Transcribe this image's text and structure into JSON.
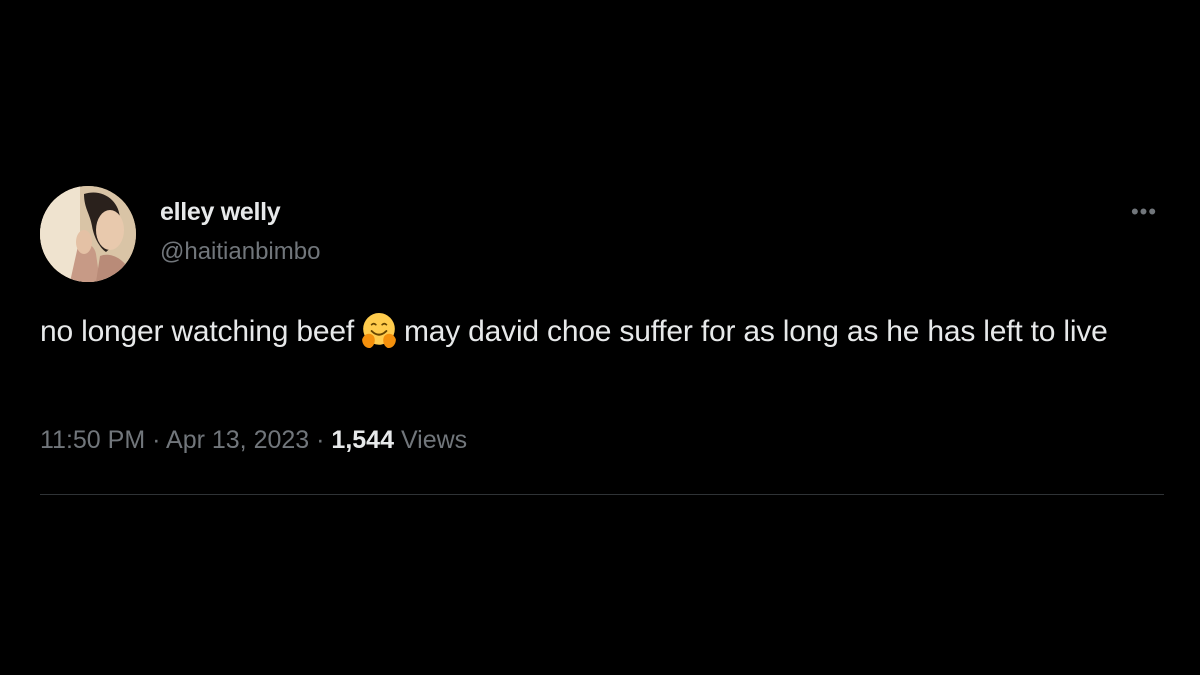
{
  "tweet": {
    "display_name": "elley welly",
    "handle": "@haitianbimbo",
    "more_icon": "more-horizontal-icon",
    "text_before_emoji": "no longer watching beef",
    "emoji": "hugging-face-emoji",
    "text_after_emoji": "may david choe suffer for as long as he has left to live",
    "time": "11:50 PM",
    "separator": "·",
    "date": "Apr 13, 2023",
    "views_count": "1,544",
    "views_label": "Views"
  },
  "colors": {
    "background": "#000000",
    "primary_text": "#e7e9ea",
    "secondary_text": "#71767b",
    "divider": "#2f3336"
  }
}
